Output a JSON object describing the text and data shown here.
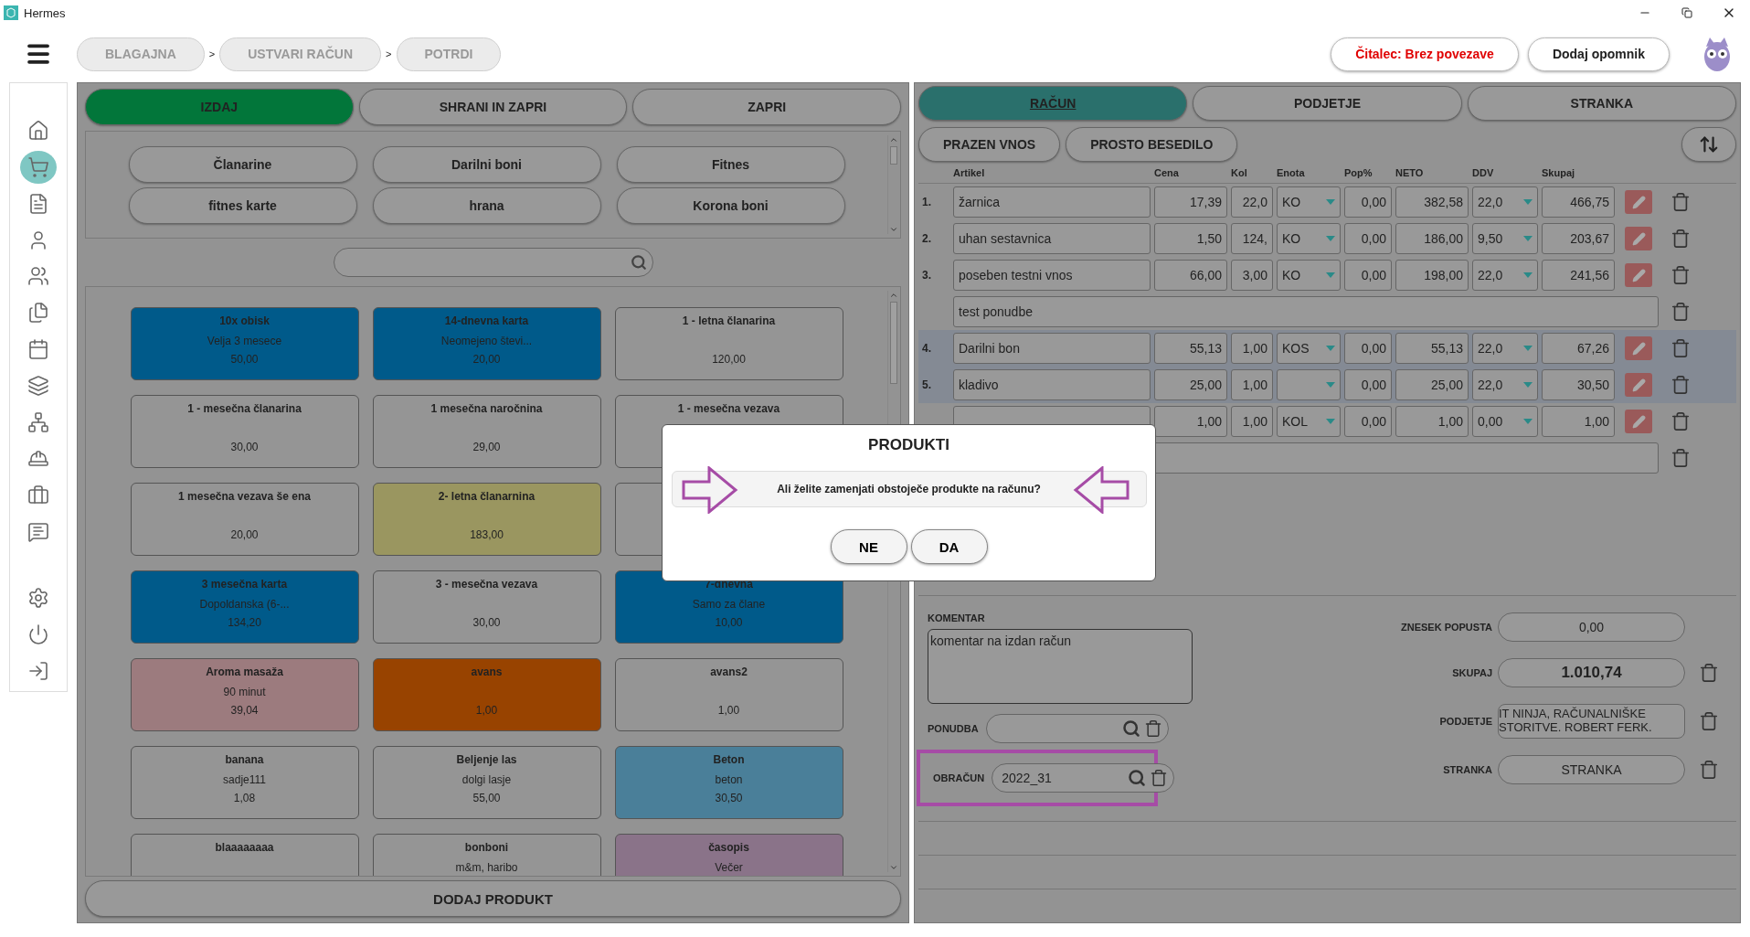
{
  "window": {
    "title": "Hermes"
  },
  "breadcrumbs": [
    {
      "label": "BLAGAJNA",
      "separator": ">"
    },
    {
      "label": "USTVARI RAČUN",
      "separator": ">"
    },
    {
      "label": "POTRDI"
    }
  ],
  "header_buttons": [
    {
      "label": "Čitalec: Brez povezave",
      "kind": "alert"
    },
    {
      "label": "Dodaj opomnik",
      "kind": "plain"
    }
  ],
  "sidebar": {
    "items": [
      {
        "kind": "home",
        "selected": false
      },
      {
        "kind": "cart",
        "selected": true
      },
      {
        "kind": "document",
        "selected": false
      },
      {
        "kind": "user",
        "selected": false
      },
      {
        "kind": "users",
        "selected": false
      },
      {
        "kind": "files",
        "selected": false
      },
      {
        "kind": "calendar",
        "selected": false
      },
      {
        "kind": "layers",
        "selected": false
      },
      {
        "kind": "network",
        "selected": false
      },
      {
        "kind": "worker",
        "selected": false
      },
      {
        "kind": "briefcase",
        "selected": false
      },
      {
        "kind": "messages",
        "selected": false
      }
    ],
    "bottom_items": [
      {
        "kind": "settings",
        "selected": false
      },
      {
        "kind": "power",
        "selected": false
      },
      {
        "kind": "login",
        "selected": false
      }
    ]
  },
  "actions": [
    {
      "label": "IZDAJ",
      "kind": "primary"
    },
    {
      "label": "SHRANI IN ZAPRI",
      "kind": "plain"
    },
    {
      "label": "ZAPRI",
      "kind": "plain"
    }
  ],
  "categories": [
    "Članarine",
    "Darilni boni",
    "Fitnes",
    "fitnes karte",
    "hrana",
    "Korona boni"
  ],
  "products": [
    {
      "name": "10x obisk",
      "desc": "Velja 3 mesece",
      "price": "50,00",
      "color": "#005a8a"
    },
    {
      "name": "14-dnevna karta",
      "desc": "Neomejeno števi...",
      "price": "20,00",
      "color": "#005a8a"
    },
    {
      "name": "1 - letna članarina",
      "price": "120,00",
      "color": "#959595"
    },
    {
      "name": "1 - mesečna članarina",
      "price": "30,00",
      "color": "#959595"
    },
    {
      "name": "1 mesečna naročnina",
      "price": "29,00",
      "color": "#959595"
    },
    {
      "name": "1 - mesečna vezava",
      "color": "#959595"
    },
    {
      "name": "1 mesečna vezava še ena",
      "price": "20,00",
      "color": "#959595"
    },
    {
      "name": "2- letna članarnina",
      "price": "183,00",
      "color": "#9a9660"
    },
    {
      "color": "#959595"
    },
    {
      "name": "3 mesečna karta",
      "desc": "Dopoldanska (6-...",
      "price": "134,20",
      "color": "#005a8a"
    },
    {
      "name": "3 - mesečna vezava",
      "price": "30,00",
      "color": "#959595"
    },
    {
      "name": "7-dnevna",
      "desc": "Samo za člane",
      "price": "10,00",
      "color": "#005a8a"
    },
    {
      "name": "Aroma masaža",
      "desc": "90 minut",
      "price": "39,04",
      "color": "#9c7b7e"
    },
    {
      "name": "avans",
      "price": "1,00",
      "color": "#984300"
    },
    {
      "name": "avans2",
      "price": "1,00",
      "color": "#959595"
    },
    {
      "name": "banana",
      "desc": "sadje111",
      "price": "1,08",
      "color": "#959595"
    },
    {
      "name": "Beljenje las",
      "desc": "dolgi lasje",
      "price": "55,00",
      "color": "#959595"
    },
    {
      "name": "Beton",
      "desc": "beton",
      "price": "30,50",
      "color": "#4a7f99"
    },
    {
      "name": "blaaaaaaaa",
      "color": "#959595"
    },
    {
      "name": "bonboni",
      "desc": "m&m, haribo",
      "color": "#959595"
    },
    {
      "name": "časopis",
      "desc": "Večer",
      "color": "#8a7389"
    }
  ],
  "add_product": "DODAJ PRODUKT",
  "tabs": [
    {
      "label": "RAČUN",
      "selected": true
    },
    {
      "label": "PODJETJE",
      "selected": false
    },
    {
      "label": "STRANKA",
      "selected": false
    }
  ],
  "entry_buttons": [
    "PRAZEN VNOS",
    "PROSTO BESEDILO"
  ],
  "table": {
    "columns": [
      "Artikel",
      "Cena",
      "Kol",
      "Enota",
      "Pop%",
      "NETO",
      "DDV",
      "Skupaj"
    ],
    "rows": [
      {
        "kind": "item",
        "selected": false,
        "num": "1.",
        "article": "žarnica",
        "price": "17,39",
        "qty": "22,0",
        "unit": "KO",
        "discount": "0,00",
        "net": "382,58",
        "vat": "22,0",
        "total": "466,75"
      },
      {
        "kind": "item",
        "selected": false,
        "num": "2.",
        "article": "uhan sestavnica",
        "price": "1,50",
        "qty": "124,",
        "unit": "KO",
        "discount": "0,00",
        "net": "186,00",
        "vat": "9,50",
        "total": "203,67"
      },
      {
        "kind": "item",
        "selected": false,
        "num": "3.",
        "article": "poseben testni vnos",
        "price": "66,00",
        "qty": "3,00",
        "unit": "KO",
        "discount": "0,00",
        "net": "198,00",
        "vat": "22,0",
        "total": "241,56"
      },
      {
        "kind": "text",
        "selected": false,
        "text": "test ponudbe"
      },
      {
        "kind": "item",
        "selected": true,
        "num": "4.",
        "article": "Darilni bon",
        "price": "55,13",
        "qty": "1,00",
        "unit": "KOS",
        "discount": "0,00",
        "net": "55,13",
        "vat": "22,0",
        "total": "67,26"
      },
      {
        "kind": "item",
        "selected": true,
        "num": "5.",
        "article": "kladivo",
        "price": "25,00",
        "qty": "1,00",
        "discount": "0,00",
        "net": "25,00",
        "vat": "22,0",
        "total": "30,50"
      },
      {
        "kind": "item",
        "selected": false,
        "price": "1,00",
        "qty": "1,00",
        "unit": "KOL",
        "discount": "0,00",
        "net": "1,00",
        "vat": "0,00",
        "total": "1,00"
      },
      {
        "kind": "text",
        "selected": false
      }
    ]
  },
  "comment": {
    "label": "KOMENTAR",
    "value": "komentar na izdan račun"
  },
  "offer": {
    "label": "PONUDBA"
  },
  "settlement": {
    "label": "OBRAČUN",
    "value": "2022_31",
    "annotated": true
  },
  "summary": [
    {
      "label": "ZNESEK POPUSTA",
      "value": "0,00",
      "kind": "plain",
      "deletable": false
    },
    {
      "label": "SKUPAJ",
      "value": "1.010,74",
      "kind": "total",
      "deletable": true
    },
    {
      "label": "PODJETJE",
      "value": "IT NINJA, RAČUNALNIŠKE STORITVE. ROBERT FERK.",
      "kind": "scroll",
      "deletable": true
    },
    {
      "label": "STRANKA",
      "value": "STRANKA",
      "kind": "plain",
      "deletable": true
    }
  ],
  "dialog": {
    "title": "PRODUKTI",
    "message": "Ali želite zamenjati obstoječe produkte na računu?",
    "arrows": true,
    "buttons": [
      "NE",
      "DA"
    ]
  }
}
